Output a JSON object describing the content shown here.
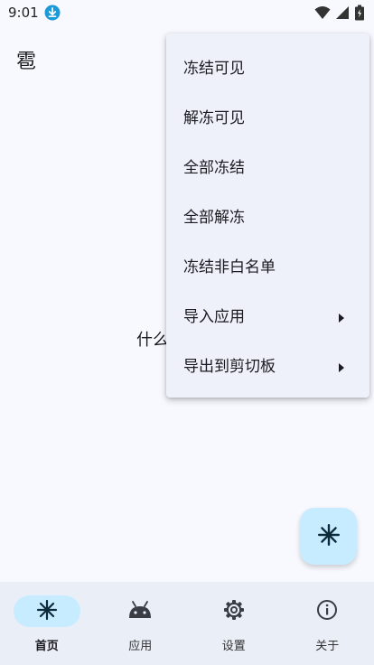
{
  "status_bar": {
    "time": "9:01",
    "icons": [
      "download-icon",
      "wifi-icon",
      "signal-icon",
      "battery-icon"
    ]
  },
  "app": {
    "title": "雹"
  },
  "main": {
    "empty_text": "什么"
  },
  "menu": {
    "items": [
      {
        "label": "冻结可见",
        "has_submenu": false
      },
      {
        "label": "解冻可见",
        "has_submenu": false
      },
      {
        "label": "全部冻结",
        "has_submenu": false
      },
      {
        "label": "全部解冻",
        "has_submenu": false
      },
      {
        "label": "冻结非白名单",
        "has_submenu": false
      },
      {
        "label": "导入应用",
        "has_submenu": true
      },
      {
        "label": "导出到剪切板",
        "has_submenu": true
      }
    ]
  },
  "fab": {
    "icon": "snowflake-icon"
  },
  "bottom_nav": {
    "items": [
      {
        "label": "首页",
        "icon": "snowflake-icon",
        "active": true
      },
      {
        "label": "应用",
        "icon": "android-icon",
        "active": false
      },
      {
        "label": "设置",
        "icon": "gear-icon",
        "active": false
      },
      {
        "label": "关于",
        "icon": "info-icon",
        "active": false
      }
    ]
  },
  "colors": {
    "background": "#f8f9ff",
    "accent_container": "#c8ecff",
    "download_badge": "#1a9ad9",
    "nav_background": "#e9eef7",
    "menu_background": "#eef0fa"
  }
}
